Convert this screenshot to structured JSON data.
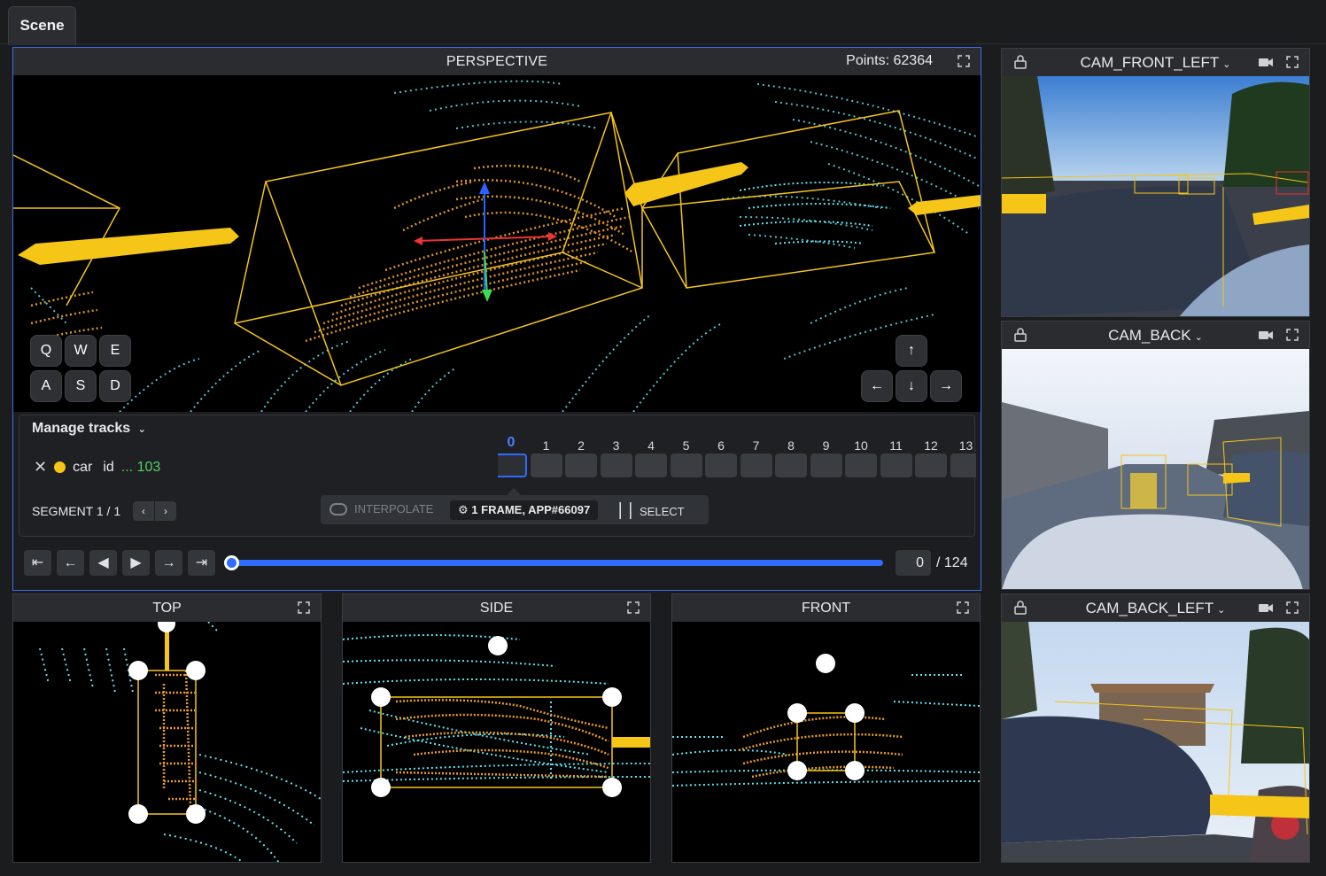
{
  "tab": {
    "label": "Scene"
  },
  "perspective": {
    "title": "PERSPECTIVE",
    "points_label": "Points: 62364",
    "keys_row1": [
      "Q",
      "W",
      "E"
    ],
    "keys_row2": [
      "A",
      "S",
      "D"
    ],
    "arrows": {
      "up": "↑",
      "left": "←",
      "down": "↓",
      "right": "→"
    }
  },
  "tracks": {
    "manage_label": "Manage tracks",
    "track": {
      "label": "car",
      "id_label": "id",
      "id_value": "... 103",
      "color": "#f5c518"
    },
    "segment_label": "SEGMENT 1 / 1",
    "frames": [
      "0",
      "1",
      "2",
      "3",
      "4",
      "5",
      "6",
      "7",
      "8",
      "9",
      "10",
      "11",
      "12",
      "13"
    ],
    "toolbar": {
      "interpolate": "INTERPOLATE",
      "frame_info": "1 FRAME, APP#66097",
      "select": "SELECT"
    }
  },
  "playback": {
    "frame_value": "0",
    "frame_total": "/ 124",
    "progress": 0
  },
  "views": {
    "top": "TOP",
    "side": "SIDE",
    "front": "FRONT"
  },
  "cameras": {
    "front_left": "CAM_FRONT_LEFT",
    "back": "CAM_BACK",
    "back_left": "CAM_BACK_LEFT"
  },
  "colors": {
    "accent": "#2f6bff",
    "box": "#f5c518",
    "cloud_near": "#e89a2a",
    "cloud_far": "#5fe3f0",
    "id_value": "#52d160"
  }
}
